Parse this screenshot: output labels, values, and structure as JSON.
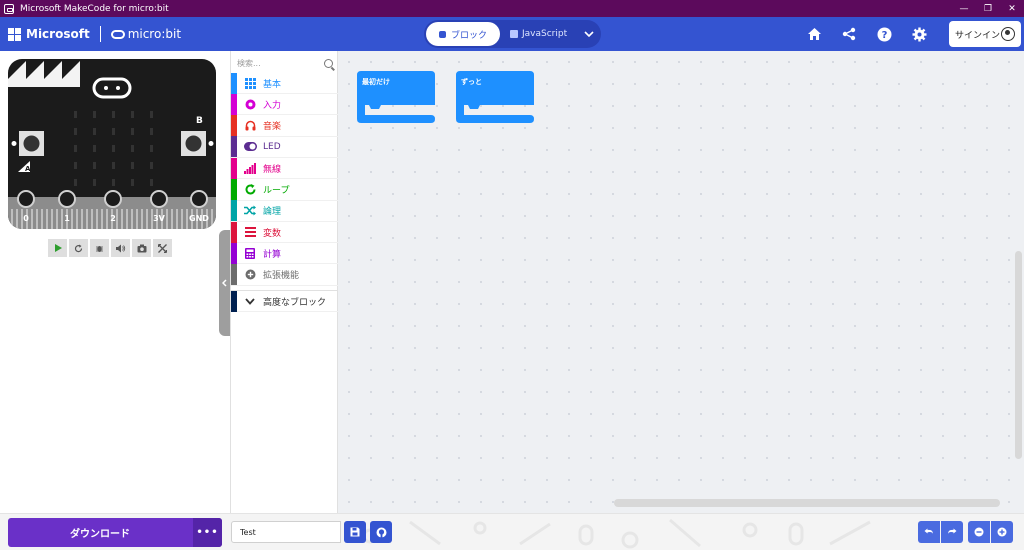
{
  "window": {
    "title": "Microsoft MakeCode for micro:bit"
  },
  "header": {
    "brand": "Microsoft",
    "product": "micro:bit",
    "modes": {
      "blocks": "ブロック",
      "javascript": "JavaScript"
    },
    "signin": "サインイン"
  },
  "simulator": {
    "pins": [
      "0",
      "1",
      "2",
      "3V",
      "GND"
    ],
    "buttons": {
      "a": "A",
      "b": "B"
    }
  },
  "toolbox": {
    "search_placeholder": "検索...",
    "categories": [
      {
        "label": "基本",
        "color": "#1e90ff",
        "icon": "grid-icon"
      },
      {
        "label": "入力",
        "color": "#d400d4",
        "icon": "input-icon"
      },
      {
        "label": "音楽",
        "color": "#e63022",
        "icon": "headphones-icon"
      },
      {
        "label": "LED",
        "color": "#5c2d91",
        "icon": "toggle-icon"
      },
      {
        "label": "無線",
        "color": "#e3008c",
        "icon": "signal-icon"
      },
      {
        "label": "ループ",
        "color": "#00aa00",
        "icon": "loop-icon"
      },
      {
        "label": "論理",
        "color": "#00a4a6",
        "icon": "shuffle-icon"
      },
      {
        "label": "変数",
        "color": "#dc143c",
        "icon": "list-icon"
      },
      {
        "label": "計算",
        "color": "#9400d3",
        "icon": "calculator-icon"
      },
      {
        "label": "拡張機能",
        "color": "#6c6c6c",
        "icon": "plus-circle-icon"
      }
    ],
    "advanced": {
      "label": "高度なブロック",
      "color": "#002050"
    }
  },
  "workspace": {
    "blocks": [
      {
        "label": "最初だけ",
        "color": "#1e90ff"
      },
      {
        "label": "ずっと",
        "color": "#1e90ff"
      }
    ]
  },
  "footer": {
    "download": "ダウンロード",
    "more": "•••",
    "project_name": "Test"
  }
}
